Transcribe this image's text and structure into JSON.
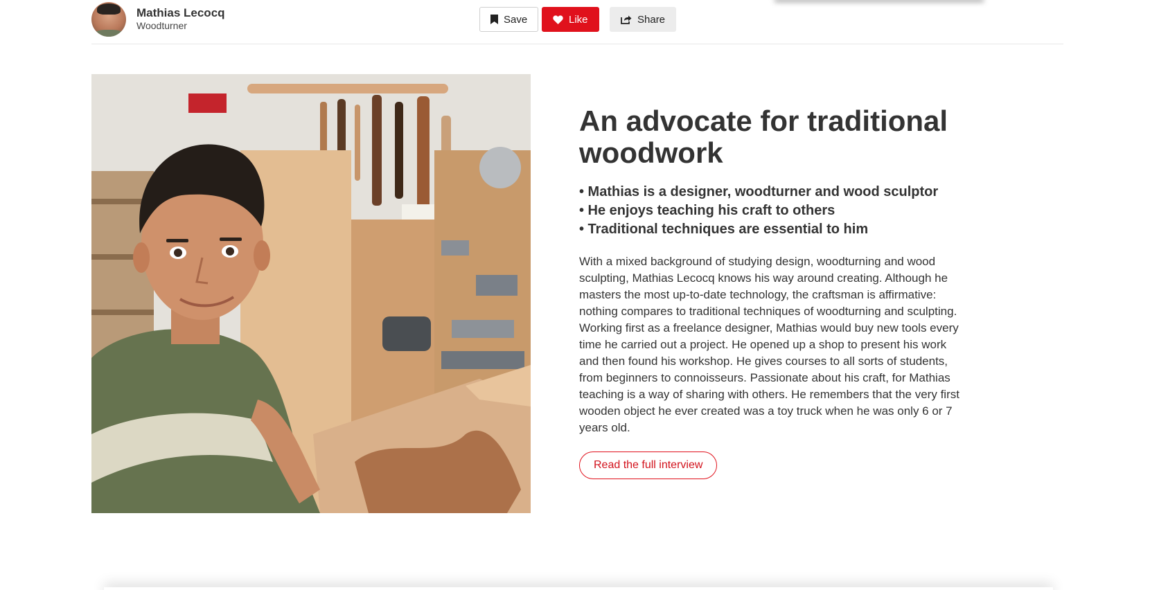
{
  "author": {
    "name": "Mathias Lecocq",
    "role": "Woodturner"
  },
  "actions": {
    "save_label": "Save",
    "like_label": "Like",
    "share_label": "Share"
  },
  "article": {
    "headline": "An advocate for traditional woodwork",
    "bullets": [
      "• Mathias is a designer, woodturner and wood sculptor",
      "• He enjoys teaching his craft to others",
      "• Traditional techniques are essential to him"
    ],
    "body": "With a mixed background of studying design, woodturning and wood sculpting, Mathias Lecocq knows his way around creating. Although he masters the most up-to-date technology, the craftsman is affirmative: nothing compares to traditional techniques of woodturning and sculpting. Working first as a freelance designer, Mathias would buy new tools every time he carried out a project. He opened up a shop to present his work and then found his workshop. He gives courses to all sorts of students, from beginners to connoisseurs. Passionate about his craft, for Mathias teaching is a way of sharing with others. He remembers that the very first wooden object he ever created was a toy truck when he was only 6 or 7 years old.",
    "cta_label": "Read the full interview"
  },
  "icons": {
    "save": "bookmark-icon",
    "like": "heart-icon",
    "share": "share-icon"
  },
  "colors": {
    "accent": "#e0111c",
    "text": "#333333",
    "share_bg": "#ececec"
  }
}
